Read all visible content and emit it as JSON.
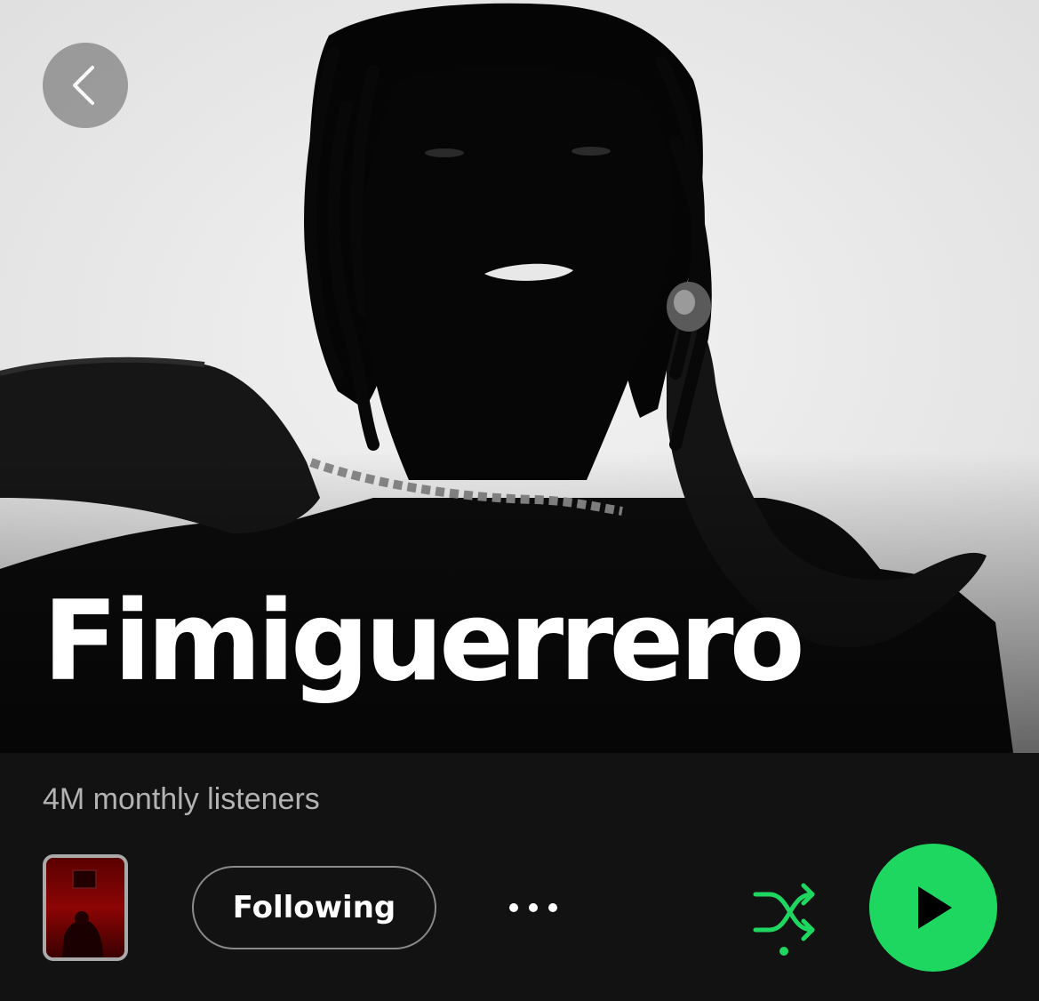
{
  "artist": {
    "name": "Fimiguerrero",
    "monthly_listeners": "4M monthly listeners",
    "photo": "artist-photo-bw"
  },
  "navigation": {
    "back_icon": "chevron-left-icon"
  },
  "actions": {
    "follow_label": "Following",
    "more_icon": "ellipsis-icon",
    "shuffle_icon": "shuffle-icon",
    "shuffle_enabled": true,
    "play_icon": "play-icon",
    "release_thumbnail": "latest-release-cover"
  },
  "colors": {
    "accent": "#1ed760",
    "background": "#121212",
    "secondary_text": "#b3b3b3"
  }
}
